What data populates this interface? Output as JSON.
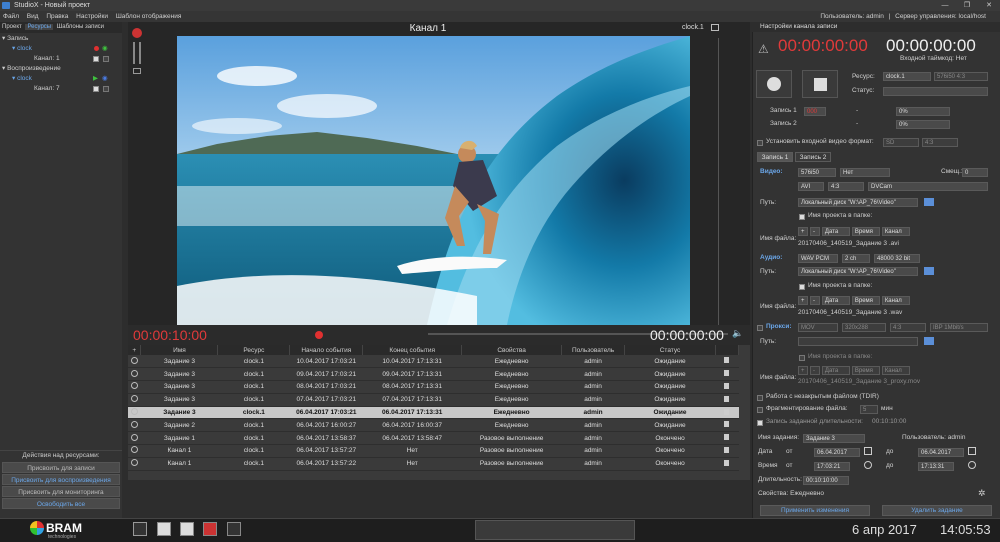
{
  "window": {
    "title": "StudioX - Новый проект",
    "controls": [
      "—",
      "❐",
      "✕"
    ]
  },
  "menu": {
    "items": [
      "Файл",
      "Вид",
      "Правка",
      "Настройки",
      "Шаблон отображения"
    ],
    "user": "Пользователь: admin",
    "server": "Сервер управления: local/host"
  },
  "left_tabs": [
    "Проект",
    "Ресурсы",
    "Шаблоны записи"
  ],
  "tree": {
    "record": "Запись",
    "record_clock": "clock",
    "record_channel": "Канал: 1",
    "play": "Воспроизведение",
    "play_clock": "clock",
    "play_channel": "Канал: 7"
  },
  "actions": {
    "title": "Действия над ресурсами:",
    "buttons": [
      "Присвоить для записи",
      "Присвоить для воспроизведения",
      "Присвоить для мониторинга",
      "Освободить все"
    ]
  },
  "preview": {
    "title": "Канал 1",
    "clock": "clock.1"
  },
  "transport": {
    "tc_left": "00:00:10:00",
    "tc_right": "00:00:00:00"
  },
  "grid": {
    "columns": [
      "Имя",
      "Ресурс",
      "Начало события",
      "Конец события",
      "Свойства",
      "Пользователь",
      "Статус"
    ],
    "rows": [
      [
        "Задание 3",
        "clock.1",
        "10.04.2017 17:03:21",
        "10.04.2017 17:13:31",
        "Ежедневно",
        "admin",
        "Ожидание"
      ],
      [
        "Задание 3",
        "clock.1",
        "09.04.2017 17:03:21",
        "09.04.2017 17:13:31",
        "Ежедневно",
        "admin",
        "Ожидание"
      ],
      [
        "Задание 3",
        "clock.1",
        "08.04.2017 17:03:21",
        "08.04.2017 17:13:31",
        "Ежедневно",
        "admin",
        "Ожидание"
      ],
      [
        "Задание 3",
        "clock.1",
        "07.04.2017 17:03:21",
        "07.04.2017 17:13:31",
        "Ежедневно",
        "admin",
        "Ожидание"
      ],
      [
        "Задание 3",
        "clock.1",
        "06.04.2017 17:03:21",
        "06.04.2017 17:13:31",
        "Ежедневно",
        "admin",
        "Ожидание"
      ],
      [
        "Задание 2",
        "clock.1",
        "06.04.2017 16:00:27",
        "06.04.2017 16:00:37",
        "Ежедневно",
        "admin",
        "Ожидание"
      ],
      [
        "Задание 1",
        "clock.1",
        "06.04.2017 13:58:37",
        "06.04.2017 13:58:47",
        "Разовое выполнение",
        "admin",
        "Окончено"
      ],
      [
        "Канал 1",
        "clock.1",
        "06.04.2017 13:57:27",
        "Нет",
        "Разовое выполнение",
        "admin",
        "Окончено"
      ],
      [
        "Канал 1",
        "clock.1",
        "06.04.2017 13:57:22",
        "Нет",
        "Разовое выполнение",
        "admin",
        "Окончено"
      ]
    ]
  },
  "rp": {
    "title": "Настройки канала записи",
    "tc_red": "00:00:00:00",
    "tc_white": "00:00:00:00",
    "input_tc": "Входной таймкод: Нет",
    "resource_label": "Ресурс:",
    "resource_value": "clock.1",
    "resource_format": "576i50 4:3",
    "status_label": "Статус:",
    "rec1_label": "Запись 1",
    "rec1_value": "000",
    "rec1_dash": "-",
    "rec1_pct": "0%",
    "rec2_label": "Запись 2",
    "rec2_dash": "-",
    "rec2_pct": "0%",
    "set_format": "Установить входной видео формат:",
    "set_format_v1": "SD",
    "set_format_v2": "4:3",
    "tab1": "Запись 1",
    "tab2": "Запись 2",
    "video_label": "Видео:",
    "video_fmt": "576i50",
    "video_none": "Нет",
    "offset_label": "Смещ.:",
    "offset_value": "0",
    "video_container": "AVI",
    "video_aspect": "4:3",
    "video_codec": "DVCam",
    "path_label": "Путь:",
    "path_video": "Локальный диск \"W:\\AP_76\\Video\"",
    "proj_name_folder": "Имя проекта в папке:",
    "filename_label": "Имя файла:",
    "fn_tokens": [
      "+",
      "-",
      "Дата",
      "Время",
      "Канал"
    ],
    "fn_video": "20170406_140519_Задание 3 .avi",
    "audio_label": "Аудио:",
    "audio_fmt": "WAV PCM",
    "audio_ch": "2 ch",
    "audio_rate": "48000 32 bit",
    "path_audio": "Локальный диск \"W:\\AP_76\\Video\"",
    "fn_audio": "20170406_140519_Задание 3 .wav",
    "proxy_label": "Прокси:",
    "proxy_fmt": "MOV",
    "proxy_res": "320x288",
    "proxy_aspect": "4:3",
    "proxy_bitrate": "IBP 1Mbit/s",
    "fn_proxy": "20170406_140519_Задание 3_proxy.mov",
    "unclosed": "Работа с незакрытым файлом (TDIR)",
    "fragment": "Фрагментирование файла:",
    "fragment_val": "5",
    "fragment_unit": "мин",
    "rec_duration": "Запись заданной длительности:",
    "rec_duration_val": "00:10:10:00",
    "task_name_label": "Имя задания:",
    "task_name": "Задание 3",
    "user_label": "Пользователь: admin",
    "date_label": "Дата",
    "from": "от",
    "to": "до",
    "date_from": "06.04.2017",
    "date_to": "06.04.2017",
    "time_label": "Время",
    "time_from": "17:03:21",
    "time_to": "17:13:31",
    "duration_label": "Длительность:",
    "duration": "00:10:10:00",
    "props": "Свойства: Ежедневно",
    "apply": "Применить изменения",
    "delete": "Удалить задание"
  },
  "taskbar": {
    "brand": "BRAM",
    "brand_sub": "technologies",
    "date": "6 апр 2017",
    "time": "14:05:53"
  },
  "colors": {
    "accent": "#6ba7ea",
    "red": "#e03a3a",
    "wait": "#e0d020",
    "done": "#30d030"
  }
}
